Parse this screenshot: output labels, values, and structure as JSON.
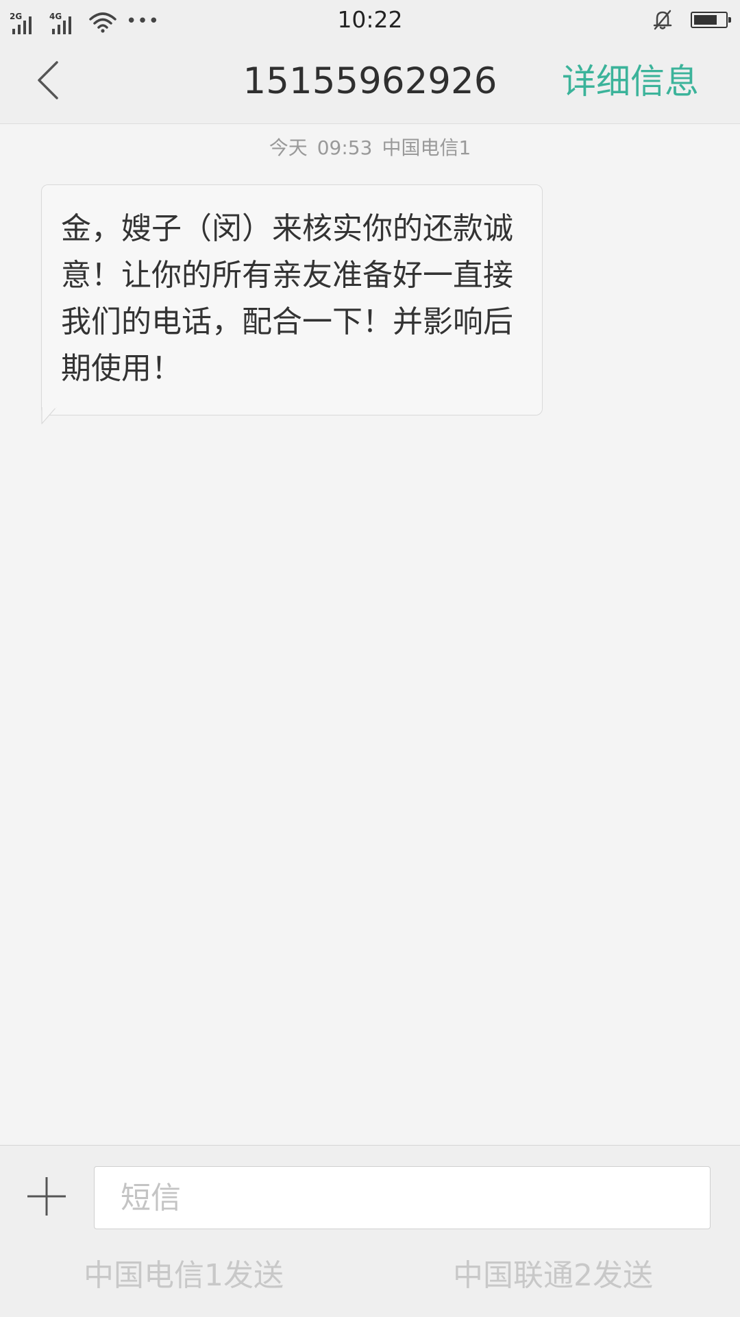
{
  "status_bar": {
    "time": "10:22",
    "sim1_network": "2G",
    "sim2_network": "4G",
    "battery_level": 0.75,
    "icons": [
      "signal-icon",
      "wifi-icon",
      "more-dots-icon",
      "bell-muted-icon",
      "battery-icon"
    ]
  },
  "header": {
    "title": "15155962926",
    "details_label": "详细信息"
  },
  "conversation": {
    "timestamp": {
      "day": "今天",
      "time": "09:53",
      "carrier": "中国电信1"
    },
    "messages": [
      {
        "direction": "incoming",
        "text": "金，嫂子（闵）来核实你的还款诚意！让你的所有亲友准备好一直接我们的电话，配合一下！并影响后期使用！"
      }
    ]
  },
  "composer": {
    "placeholder": "短信",
    "value": "",
    "send_sim1_label": "中国电信1发送",
    "send_sim2_label": "中国联通2发送"
  },
  "colors": {
    "accent": "#3bb39a",
    "background": "#f4f4f4",
    "bar_background": "#efefef",
    "disabled_text": "#c8c8c8"
  }
}
